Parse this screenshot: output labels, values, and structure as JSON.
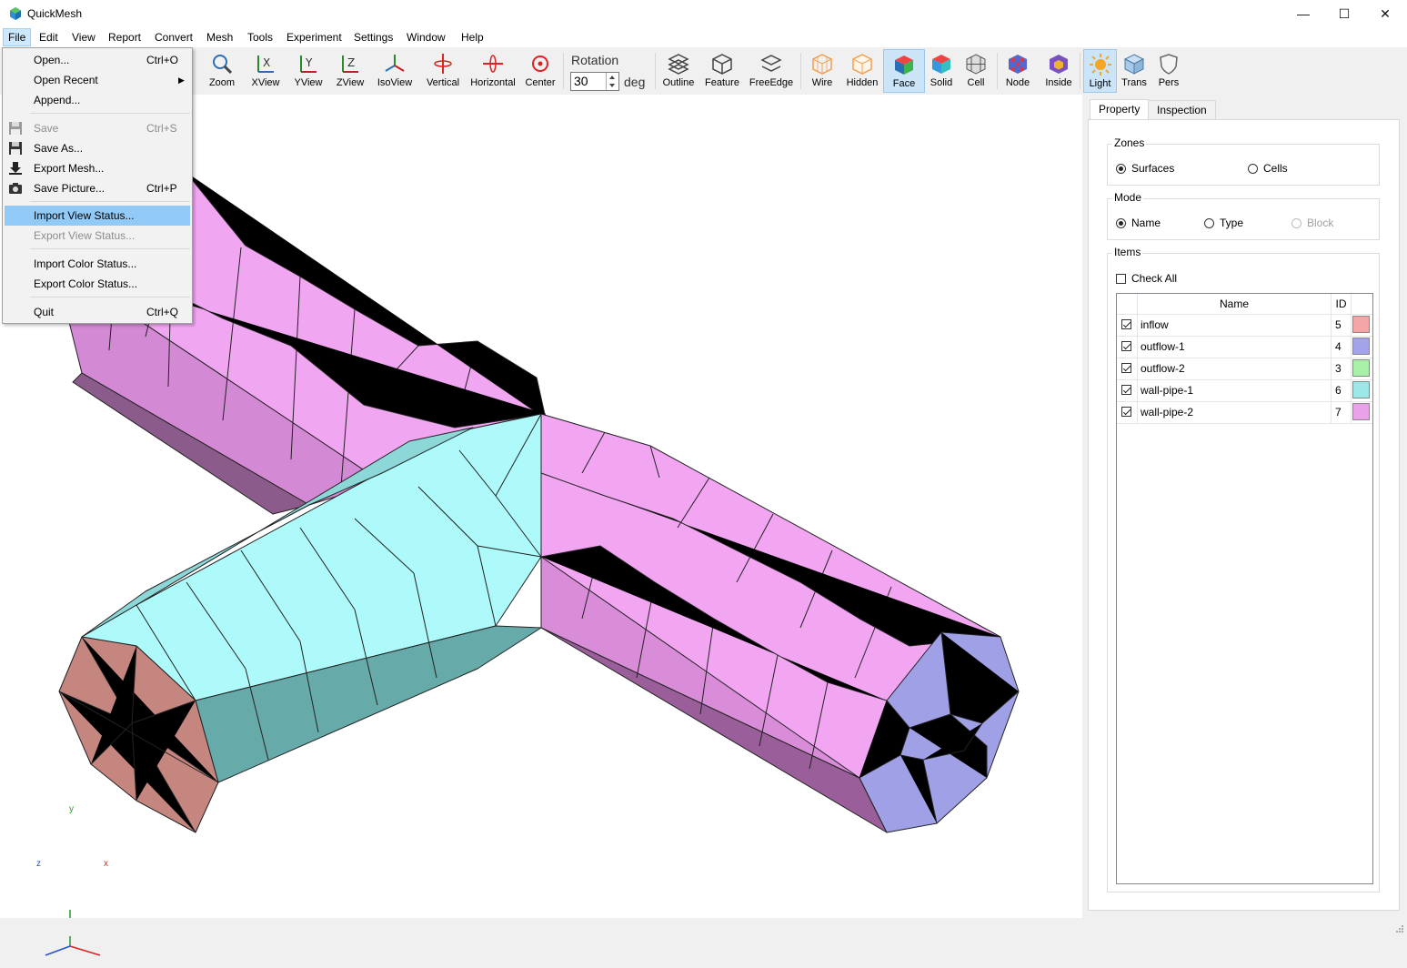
{
  "window": {
    "title": "QuickMesh",
    "minimize_glyph": "—",
    "maximize_glyph": "☐",
    "close_glyph": "✕"
  },
  "menubar": {
    "items": [
      "File",
      "Edit",
      "View",
      "Report",
      "Convert",
      "Mesh",
      "Tools",
      "Experiment",
      "Settings",
      "Window",
      "Help"
    ]
  },
  "file_menu": {
    "items": [
      {
        "label": "Open...",
        "shortcut": "Ctrl+O"
      },
      {
        "label": "Open Recent",
        "shortcut": ""
      },
      {
        "label": "Append...",
        "shortcut": ""
      },
      {
        "label": "Save",
        "shortcut": "Ctrl+S"
      },
      {
        "label": "Save As...",
        "shortcut": ""
      },
      {
        "label": "Export Mesh...",
        "shortcut": ""
      },
      {
        "label": "Save Picture...",
        "shortcut": "Ctrl+P"
      },
      {
        "label": "Import View Status...",
        "shortcut": ""
      },
      {
        "label": "Export View Status...",
        "shortcut": ""
      },
      {
        "label": "Import Color Status...",
        "shortcut": ""
      },
      {
        "label": "Export Color Status...",
        "shortcut": ""
      },
      {
        "label": "Quit",
        "shortcut": "Ctrl+Q"
      }
    ]
  },
  "toolbar": {
    "buttons": [
      "Zoom",
      "XView",
      "YView",
      "ZView",
      "IsoView",
      "Vertical",
      "Horizontal",
      "Center",
      "Outline",
      "Feature",
      "FreeEdge",
      "Wire",
      "Hidden",
      "Face",
      "Solid",
      "Cell",
      "Node",
      "Inside",
      "Light",
      "Trans",
      "Pers"
    ],
    "rotation_label": "Rotation",
    "rotation_value": "30",
    "rotation_unit": "deg"
  },
  "panel": {
    "tabs": [
      "Property",
      "Inspection"
    ],
    "zones_label": "Zones",
    "zones_options": [
      "Surfaces",
      "Cells"
    ],
    "mode_label": "Mode",
    "mode_options": [
      "Name",
      "Type",
      "Block"
    ],
    "items_label": "Items",
    "check_all": "Check All",
    "col_name": "Name",
    "col_id": "ID",
    "rows": [
      {
        "name": "inflow",
        "id": "5",
        "color": "#f4a6a6"
      },
      {
        "name": "outflow-1",
        "id": "4",
        "color": "#a3a3ea"
      },
      {
        "name": "outflow-2",
        "id": "3",
        "color": "#a8f0a8"
      },
      {
        "name": "wall-pipe-1",
        "id": "6",
        "color": "#9ee7e7"
      },
      {
        "name": "wall-pipe-2",
        "id": "7",
        "color": "#e9a2e9"
      }
    ]
  },
  "axes": {
    "x": "x",
    "y": "y",
    "z": "z"
  }
}
